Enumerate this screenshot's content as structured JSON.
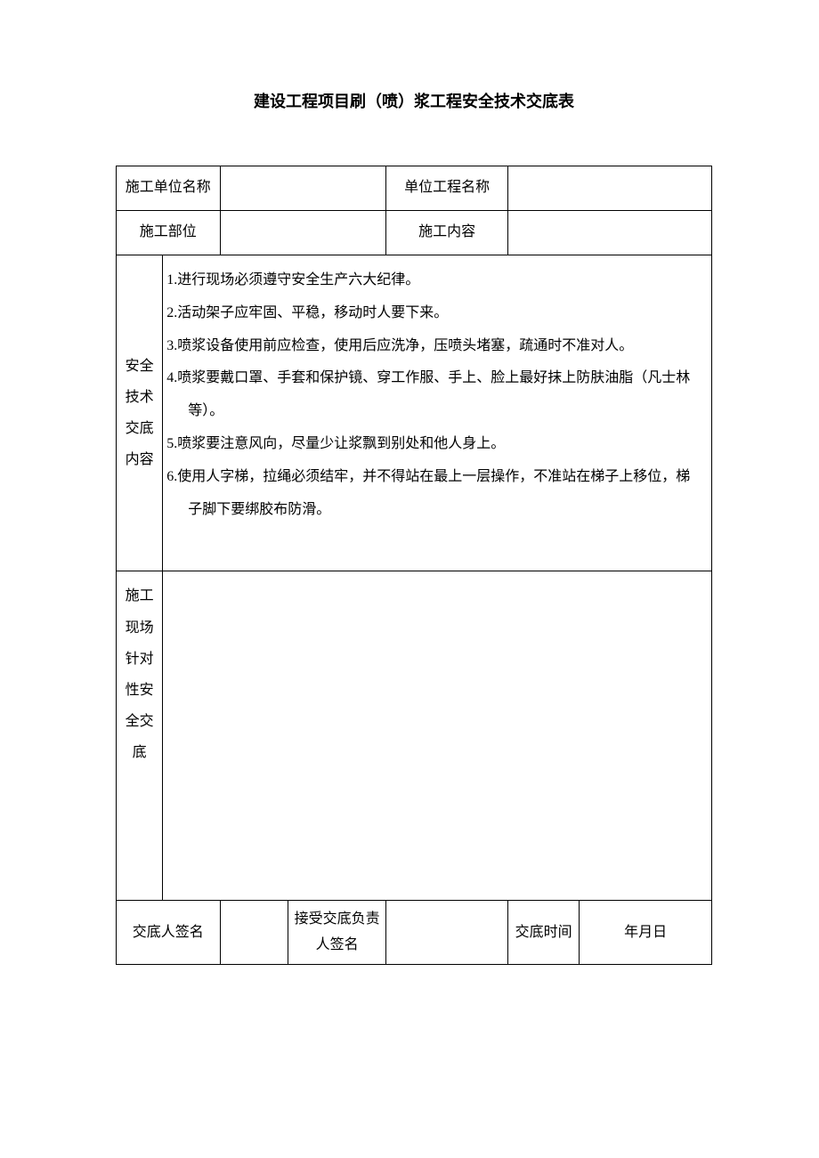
{
  "title": "建设工程项目刷（喷）浆工程安全技术交底表",
  "row1": {
    "label1": "施工单位名称",
    "value1": "",
    "label2": "单位工程名称",
    "value2": ""
  },
  "row2": {
    "label1": "施工部位",
    "value1": "",
    "label2": "施工内容",
    "value2": ""
  },
  "content": {
    "label": "安全技术交底内容",
    "items": [
      "1.进行现场必须遵守安全生产六大纪律。",
      "2.活动架子应牢固、平稳，移动时人要下来。",
      "3.喷浆设备使用前应检查，使用后应洗净，压喷头堵塞，疏通时不准对人。",
      "4.喷浆要戴口罩、手套和保护镜、穿工作服、手上、脸上最好抹上防肤油脂（凡士林等）。",
      "5.喷浆要注意风向，尽量少让浆飘到别处和他人身上。",
      "6.使用人字梯，拉绳必须结牢，并不得站在最上一层操作，不准站在梯子上移位，梯子脚下要绑胶布防滑。"
    ]
  },
  "site": {
    "label": "施工现场针对性安全交底"
  },
  "sign": {
    "label1": "交底人签名",
    "value1": "",
    "label2": "接受交底负责人签名",
    "value2": "",
    "label3": "交底时间",
    "value3": "年月日"
  }
}
